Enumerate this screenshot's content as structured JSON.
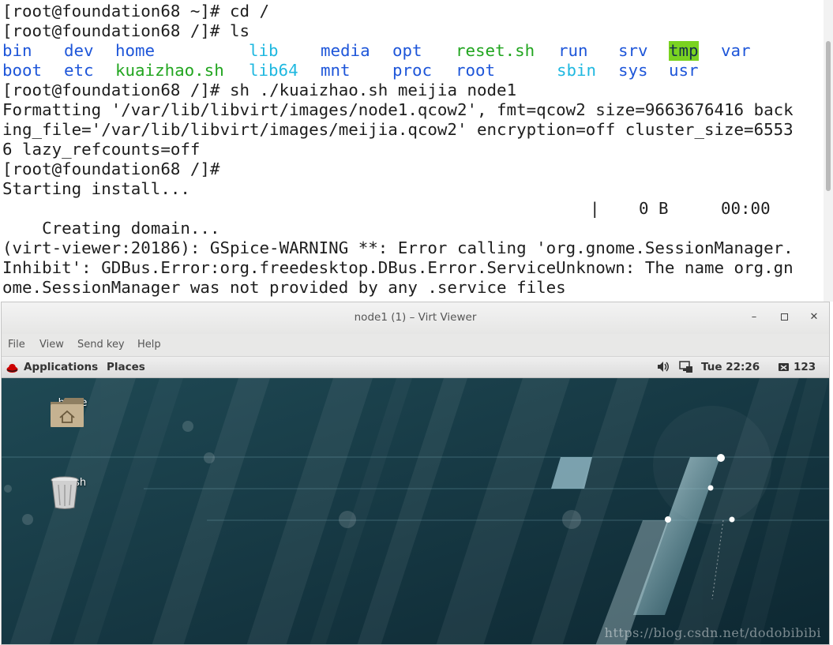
{
  "terminal": {
    "prompt_home": "[root@foundation68 ~]# ",
    "cmd_cd": "cd /",
    "prompt_root": "[root@foundation68 /]# ",
    "cmd_ls": "ls",
    "ls_row1": [
      "bin",
      "dev",
      "home",
      "lib",
      "media",
      "opt",
      "reset.sh",
      "run",
      "srv",
      "tmp",
      "var"
    ],
    "ls_row2": [
      "boot",
      "etc",
      "kuaizhao.sh",
      "lib64",
      "mnt",
      "proc",
      "root",
      "sbin",
      "sys",
      "usr"
    ],
    "cmd_sh": "sh ./kuaizhao.sh meijia node1",
    "out1": "Formatting '/var/lib/libvirt/images/node1.qcow2', fmt=qcow2 size=9663676416 back",
    "out2": "ing_file='/var/lib/libvirt/images/meijia.qcow2' encryption=off cluster_size=6553",
    "out3": "6 lazy_refcounts=off",
    "prompt_empty": "[root@foundation68 /]#",
    "out4": "Starting install...",
    "out5": "Creating domain...",
    "progress_sep": "|",
    "progress_size": "0 B",
    "progress_time": "00:00",
    "warn1": "(virt-viewer:20186): GSpice-WARNING **: Error calling 'org.gnome.SessionManager.",
    "warn2": "Inhibit': GDBus.Error:org.freedesktop.DBus.Error.ServiceUnknown: The name org.gn",
    "warn3": "ome.SessionManager was not provided by any .service files"
  },
  "viewer": {
    "title": "node1 (1) – Virt Viewer",
    "menu": [
      "File",
      "View",
      "Send key",
      "Help"
    ],
    "minimize_glyph": "–",
    "maximize_glyph": "▫",
    "close_glyph": "✕"
  },
  "guest": {
    "applications": "Applications",
    "places": "Places",
    "clock": "Tue 22:26",
    "workspace": "123",
    "icons": [
      "home",
      "Trash"
    ],
    "watermark": "https://blog.csdn.net/dodobibibi"
  },
  "icon_names": [
    "redhat-logo-icon",
    "volume-icon",
    "network-icon",
    "keyboard-icon",
    "folder-home-icon",
    "trash-icon"
  ],
  "colors": {
    "dir": "#1e56d9",
    "link": "#1fb8e0",
    "exec": "#21a51f",
    "tmp_bg": "#7ad321",
    "desktop": "#173640"
  }
}
